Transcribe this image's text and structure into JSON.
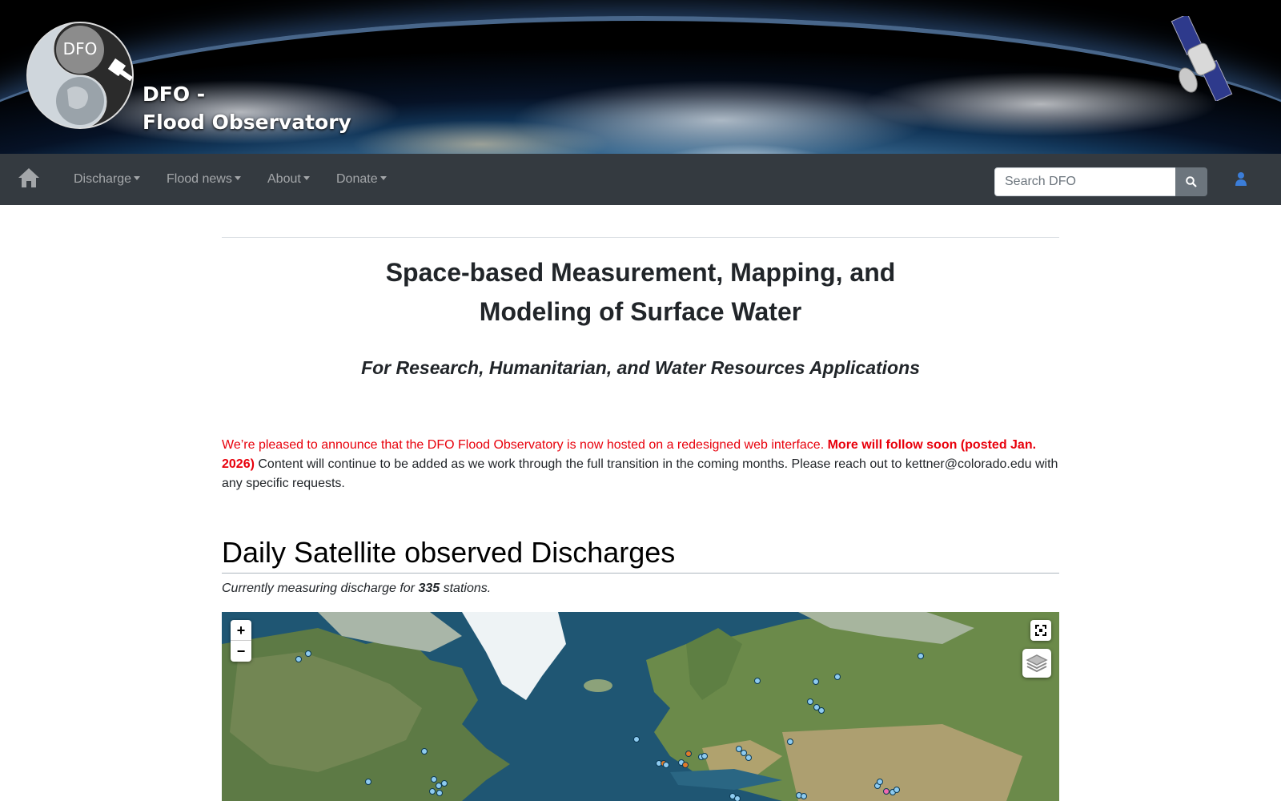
{
  "banner": {
    "logo_badge": "DFO",
    "logo_line1": "DFO -",
    "logo_line2": "Flood Observatory"
  },
  "nav": {
    "items": [
      {
        "label": "Discharge"
      },
      {
        "label": "Flood news"
      },
      {
        "label": "About"
      },
      {
        "label": "Donate"
      }
    ],
    "search_placeholder": "Search DFO",
    "icons": [
      "home-icon",
      "search-icon",
      "user-icon"
    ]
  },
  "main": {
    "title_line1": "Space-based Measurement, Mapping, and",
    "title_line2": "Modeling of Surface Water",
    "subtitle": "For Research, Humanitarian, and Water Resources Applications",
    "announce_red": "We’re pleased to announce that the DFO Flood Observatory is now hosted on a redesigned web interface.",
    "announce_bold": "More will follow soon (posted Jan. 2026)",
    "announce_rest": "Content will continue to be added as we work through the full transition in the coming months. Please reach out to kettner@colorado.edu with any specific requests.",
    "section_title": "Daily Satellite observed Discharges",
    "stations_prefix": "Currently measuring discharge for",
    "stations_count": "335",
    "stations_suffix": "stations."
  },
  "map": {
    "zoom_in": "+",
    "zoom_out": "−",
    "station_colors": {
      "normal": "#8ecbf0",
      "flood": "#e07a2a",
      "alert": "#f06ab0"
    }
  }
}
